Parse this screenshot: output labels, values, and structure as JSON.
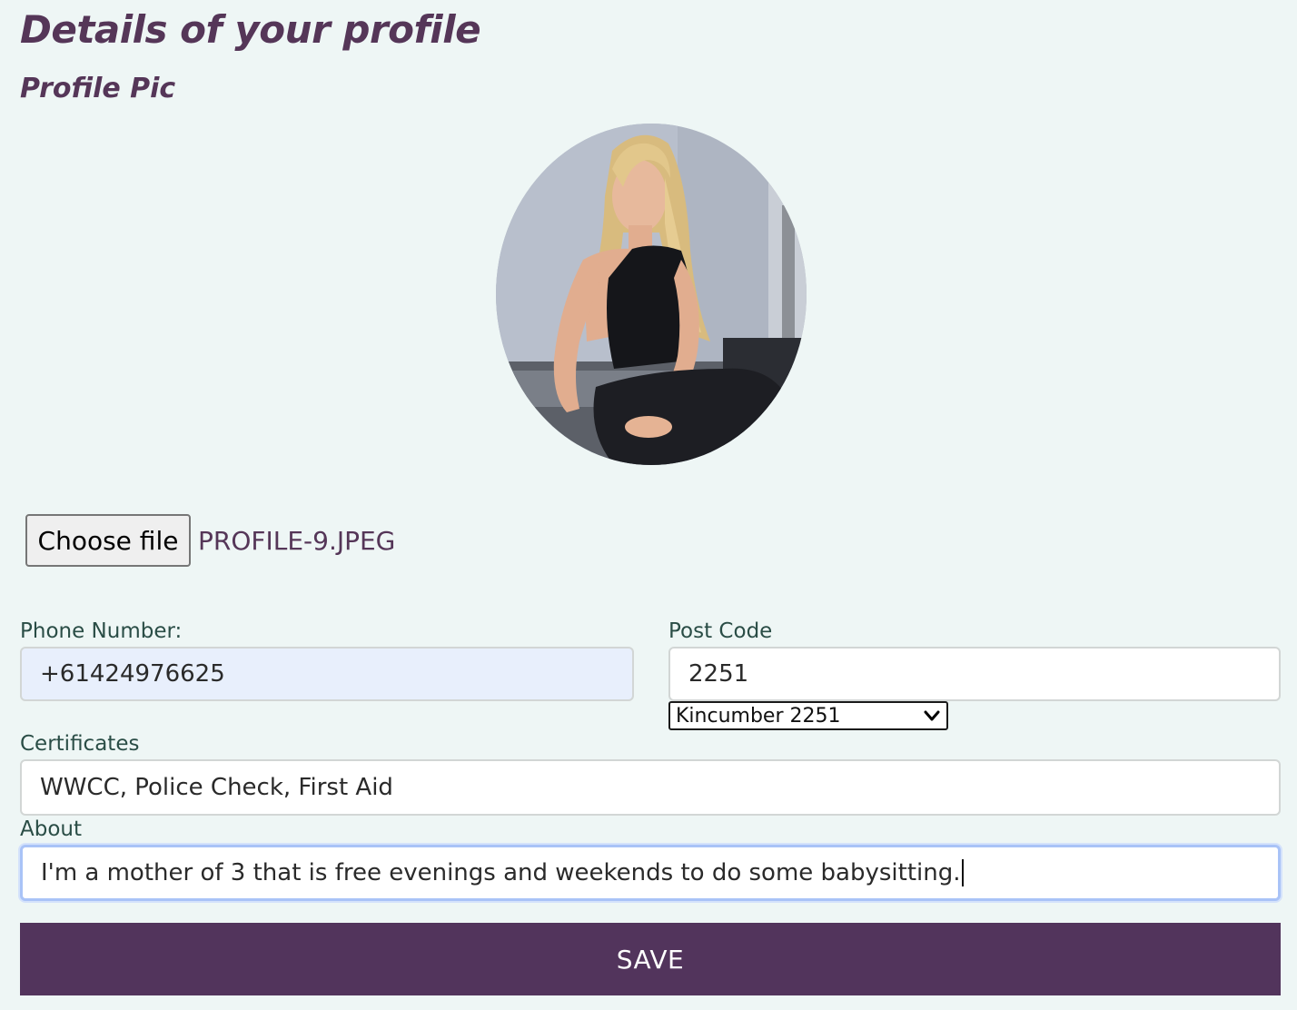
{
  "header": {
    "title": "Details of your profile",
    "profile_pic_label": "Profile Pic"
  },
  "avatar": {
    "description_icon": "profile-photo"
  },
  "file_upload": {
    "button_label": "Choose file",
    "file_name": "PROFILE-9.JPEG"
  },
  "form": {
    "phone": {
      "label": "Phone Number:",
      "value": "+61424976625"
    },
    "postcode": {
      "label": "Post Code",
      "value": "2251",
      "suburb_selected": "Kincumber 2251"
    },
    "certificates": {
      "label": "Certificates",
      "value": "WWCC, Police Check, First Aid"
    },
    "about": {
      "label": "About",
      "value": "I'm a mother of 3 that is free evenings and weekends to do some babysitting."
    }
  },
  "actions": {
    "save_label": "SAVE"
  },
  "colors": {
    "background": "#eef6f5",
    "accent": "#52345c",
    "heading": "#553658",
    "autofill": "#e8effc",
    "focus": "#a9c3f7"
  }
}
